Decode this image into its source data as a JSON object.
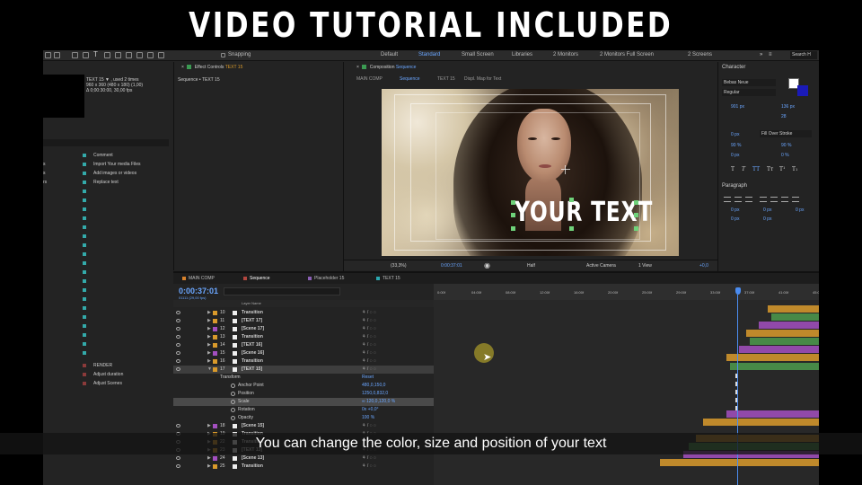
{
  "banner": {
    "title": "VIDEO TUTORIAL INCLUDED"
  },
  "topbar": {
    "snapping": "Snapping",
    "workspaces": [
      "Default",
      "Standard",
      "Small Screen",
      "Libraries",
      "2 Monitors",
      "2 Monitors Full Screen",
      "2 Screens"
    ],
    "active_workspace": "Standard",
    "search_placeholder": "Search H"
  },
  "project": {
    "item_name": "TEXT 15 ▼ , used 2 times",
    "item_dims": "960 x 360  (480 x 180) (1,00)",
    "item_dur": "Δ 0;00:30:00, 30,00 fps",
    "rows": [
      {
        "left": "",
        "label": "Comment"
      },
      {
        "left": "s",
        "label": "Import Your media Files"
      },
      {
        "left": "s",
        "label": "Add images or videos"
      },
      {
        "left": "rs",
        "label": "Replace text"
      },
      {
        "left": "",
        "label": "RENDER"
      },
      {
        "left": "",
        "label": "Adjust duration"
      },
      {
        "left": "",
        "label": "Adjust Scenes"
      }
    ]
  },
  "effect_controls": {
    "tab": "Effect Controls",
    "tab_layer": "TEXT 15",
    "subhead": "Sequence • TEXT 15"
  },
  "composition": {
    "tab": "Composition",
    "tab_name": "Sequence",
    "tabs": [
      "MAIN COMP",
      "Sequence",
      "TEXT 15",
      "Displ. Map for Text"
    ],
    "active_tab": "Sequence",
    "overlay_text": "YOUR TEXT",
    "footer": {
      "zoom": "(33,3%)",
      "timecode": "0:00:37:01",
      "resolution": "Half",
      "camera": "Active Camera",
      "views": "1 View",
      "exposure": "+0,0"
    }
  },
  "character": {
    "title": "Character",
    "font": "Bebas Neue",
    "style": "Regular",
    "size": "901 px",
    "leading": "136 px",
    "tracking": "28",
    "stroke": "0 px",
    "stroke_type": "Fill Over Stroke",
    "vscale": "90 %",
    "hscale": "90 %",
    "baseline": "0 px",
    "tsume": "0 %",
    "fill_color": "#ffffff",
    "stroke_color": "#1a1ab8",
    "paragraph_title": "Paragraph",
    "para_vals": [
      "0 px",
      "0 px",
      "0 px",
      "0 px",
      "0 px"
    ]
  },
  "timeline": {
    "tabs": [
      "MAIN COMP",
      "Sequence",
      "Placeholder 15",
      "TEXT 15"
    ],
    "active_tab": "Sequence",
    "tab_colors": [
      "#d9822b",
      "#b2463f",
      "#8a5fb5",
      "#2ba8b0"
    ],
    "timecode": "0:00:37:01",
    "timecode_sub": "01111 (29,00 fps)",
    "layer_header": "Layer Name",
    "ruler": [
      "0:00f",
      "04:00f",
      "08:00f",
      "12:00f",
      "16:00f",
      "20:00f",
      "25:00f",
      "29:00f",
      "33:00f",
      "37:00f",
      "41:00f",
      "45:00"
    ],
    "layers_top": [
      {
        "num": "10",
        "name": "Transition",
        "color": "#d99a2b"
      },
      {
        "num": "11",
        "name": "[TEXT 17]",
        "color": "#d99a2b"
      },
      {
        "num": "12",
        "name": "[Scene 17]",
        "color": "#a34fbf"
      },
      {
        "num": "13",
        "name": "Transition",
        "color": "#d99a2b"
      },
      {
        "num": "14",
        "name": "[TEXT 16]",
        "color": "#d99a2b"
      },
      {
        "num": "15",
        "name": "[Scene 16]",
        "color": "#a34fbf"
      },
      {
        "num": "16",
        "name": "Transition",
        "color": "#d99a2b"
      },
      {
        "num": "17",
        "name": "[TEXT 15]",
        "color": "#d99a2b"
      }
    ],
    "transform_label": "Transform",
    "transform_reset": "Reset",
    "properties": [
      {
        "name": "Anchor Point",
        "value": "480,0,150,0"
      },
      {
        "name": "Position",
        "value": "1250,0,832,0"
      },
      {
        "name": "Scale",
        "value": "∞ 120,0,120,0 %"
      },
      {
        "name": "Rotation",
        "value": "0x +0,0°"
      },
      {
        "name": "Opacity",
        "value": "100 %"
      }
    ],
    "layers_bottom": [
      {
        "num": "18",
        "name": "[Scene 15]",
        "color": "#a34fbf"
      },
      {
        "num": "19",
        "name": "Transition",
        "color": "#d99a2b"
      },
      {
        "num": "22",
        "name": "Transition",
        "color": "#d99a2b"
      },
      {
        "num": "23",
        "name": "[TEXT 13]",
        "color": "#d99a2b"
      },
      {
        "num": "24",
        "name": "[Scene 13]",
        "color": "#a34fbf"
      },
      {
        "num": "25",
        "name": "Transition",
        "color": "#d99a2b"
      }
    ]
  },
  "subtitle": {
    "text": "You can change the color, size and position of your text"
  }
}
